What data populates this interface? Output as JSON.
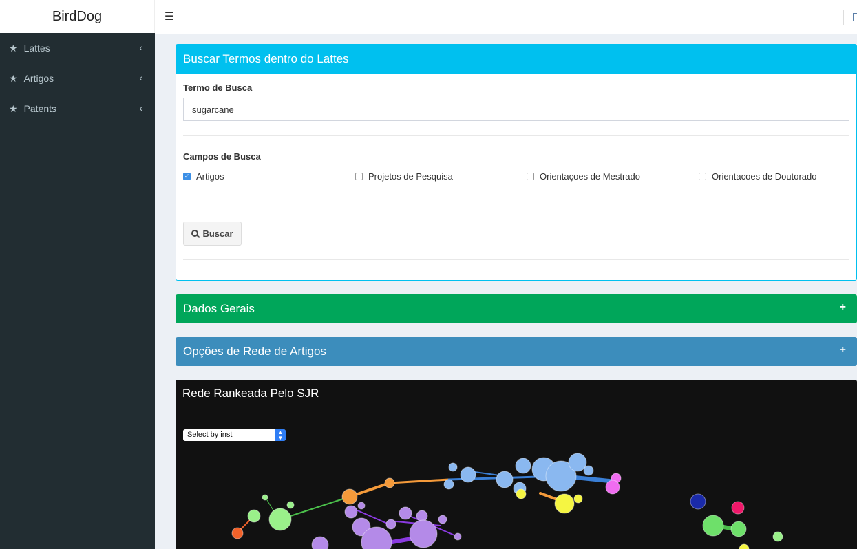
{
  "app": {
    "title": "BirdDog",
    "menu_icon": "hamburger-icon"
  },
  "sidebar": {
    "items": [
      {
        "label": "Lattes",
        "icon": "star-icon"
      },
      {
        "label": "Artigos",
        "icon": "star-icon"
      },
      {
        "label": "Patents",
        "icon": "star-icon"
      }
    ]
  },
  "search_box": {
    "title": "Buscar Termos dentro do Lattes",
    "term_label": "Termo de Busca",
    "term_value": "sugarcane",
    "fields_label": "Campos de Busca",
    "fields": [
      {
        "label": "Artigos",
        "checked": true
      },
      {
        "label": "Projetos de Pesquisa",
        "checked": false
      },
      {
        "label": "Orientaçoes de Mestrado",
        "checked": false
      },
      {
        "label": "Orientacoes de Doutorado",
        "checked": false
      }
    ],
    "button_label": "Buscar",
    "color": "#00c0ef"
  },
  "dados_gerais": {
    "title": "Dados Gerais",
    "toggle": "+",
    "color": "#00a65a"
  },
  "opcoes_rede": {
    "title": "Opções de Rede de Artigos",
    "toggle": "+",
    "color": "#3c8dbc"
  },
  "network": {
    "title": "Rede Rankeada Pelo SJR",
    "select_value": "Select by inst",
    "background": "#111111",
    "node_colors": [
      "#8ab8f0",
      "#f49a3a",
      "#f06cf0",
      "#f5f542",
      "#9af08a",
      "#b48ae8",
      "#f2622a",
      "#1a2aa8",
      "#f0186a",
      "#6ee06a"
    ]
  }
}
